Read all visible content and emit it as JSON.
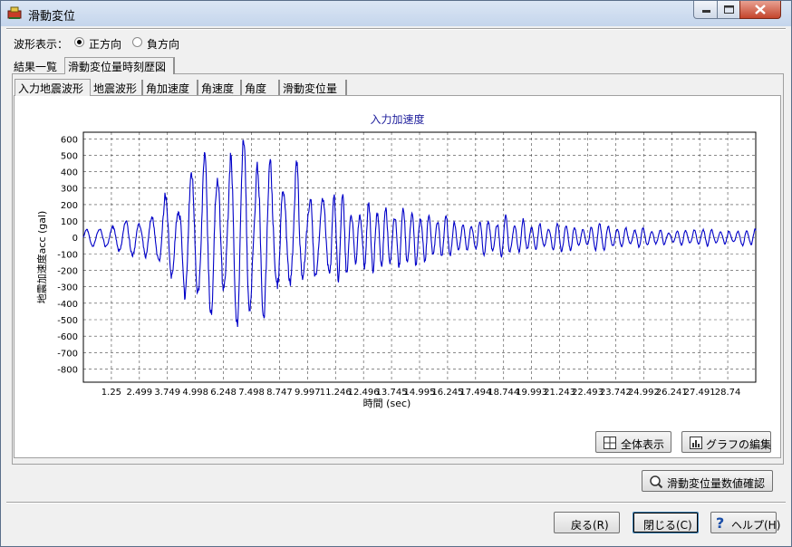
{
  "window": {
    "title": "滑動変位"
  },
  "waveform": {
    "label": "波形表示：",
    "options": [
      {
        "label": "正方向",
        "selected": true
      },
      {
        "label": "負方向",
        "selected": false
      }
    ]
  },
  "outer_tabs": [
    "結果一覧",
    "滑動変位量時刻歴図"
  ],
  "inner_tabs": [
    "入力地震波形",
    "地震波形",
    "角加速度",
    "角速度",
    "角度",
    "滑動変位量"
  ],
  "chart_data": {
    "type": "line",
    "title": "入力加速度",
    "xlabel": "時間 (sec)",
    "ylabel": "地震加速度acc (gal)",
    "ylim": [
      -880,
      640
    ],
    "xlim": [
      0,
      29.99
    ],
    "yticks": [
      600,
      500,
      400,
      300,
      200,
      100,
      0,
      -100,
      -200,
      -300,
      -400,
      -500,
      -600,
      -700,
      -800
    ],
    "xticks": [
      "1.25",
      "2.499",
      "3.749",
      "4.998",
      "6.248",
      "7.498",
      "8.747",
      "9.997",
      "11.246",
      "12.496",
      "13.745",
      "14.995",
      "16.245",
      "17.494",
      "18.744",
      "19.993",
      "21.243",
      "22.493",
      "23.742",
      "24.992",
      "26.241",
      "27.491",
      "28.74"
    ],
    "grid": true,
    "series_color": "#0000c8"
  },
  "buttons": {
    "full_view": "全体表示",
    "edit_graph": "グラフの編集",
    "check_values": "滑動変位量数値確認",
    "back": "戻る(R)",
    "close": "閉じる(C)",
    "help": "ヘルプ(H)"
  },
  "colors": {
    "accent_title": "#1e1e9c",
    "series": "#0000c8"
  }
}
